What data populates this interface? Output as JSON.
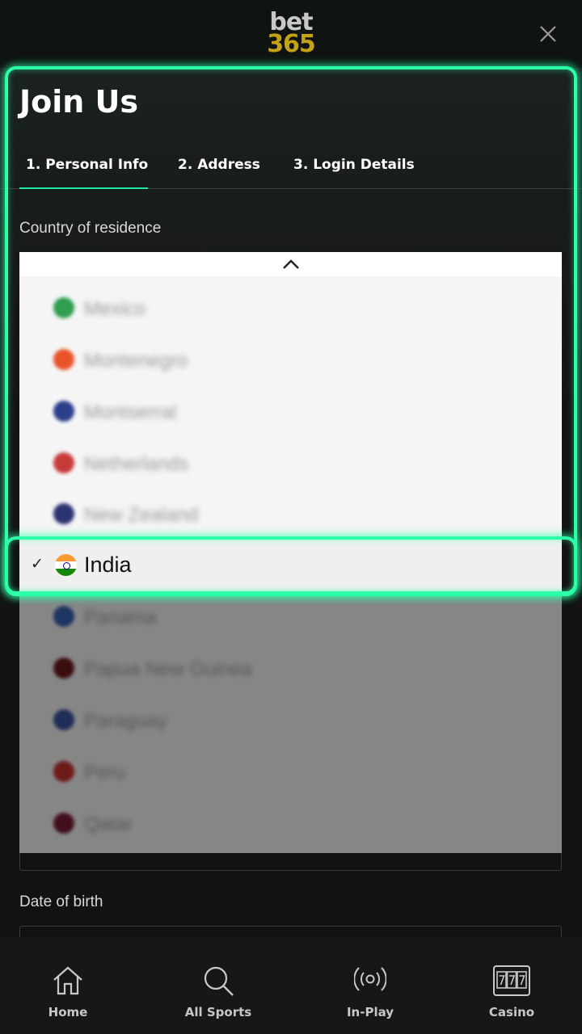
{
  "header": {
    "logo_top": "bet",
    "logo_bottom": "365",
    "close_icon": "close-icon"
  },
  "page": {
    "title": "Join Us",
    "tabs": [
      {
        "label": "1.  Personal Info",
        "active": true
      },
      {
        "label": "2.  Address",
        "active": false
      },
      {
        "label": "3.  Login Details",
        "active": false
      }
    ]
  },
  "form": {
    "country_label": "Country of residence",
    "dob_label": "Date of birth",
    "country_options": [
      {
        "name": "Mexico",
        "flag_color": "#2e9e4f"
      },
      {
        "name": "Montenegro",
        "flag_color": "#e8532a"
      },
      {
        "name": "Montserrat",
        "flag_color": "#2b3f8c"
      },
      {
        "name": "Netherlands",
        "flag_color": "#c83a3a"
      },
      {
        "name": "New Zealand",
        "flag_color": "#2a3470"
      },
      {
        "name": "Panama",
        "flag_color": "#3a5fb0"
      },
      {
        "name": "Papua New Guinea",
        "flag_color": "#6b1a1a"
      },
      {
        "name": "Paraguay",
        "flag_color": "#3a55a0"
      },
      {
        "name": "Peru",
        "flag_color": "#c83030"
      },
      {
        "name": "Qatar",
        "flag_color": "#7a1c36"
      }
    ],
    "selected_country": "India",
    "selected_check": "✓"
  },
  "bottom_nav": [
    {
      "label": "Home",
      "icon": "home-icon"
    },
    {
      "label": "All Sports",
      "icon": "search-icon"
    },
    {
      "label": "In-Play",
      "icon": "live-broadcast-icon"
    },
    {
      "label": "Casino",
      "icon": "slot-machine-icon"
    }
  ],
  "colors": {
    "accent": "#1ee6a0",
    "highlight": "#2dffa9",
    "logo_gold": "#c3a215"
  }
}
